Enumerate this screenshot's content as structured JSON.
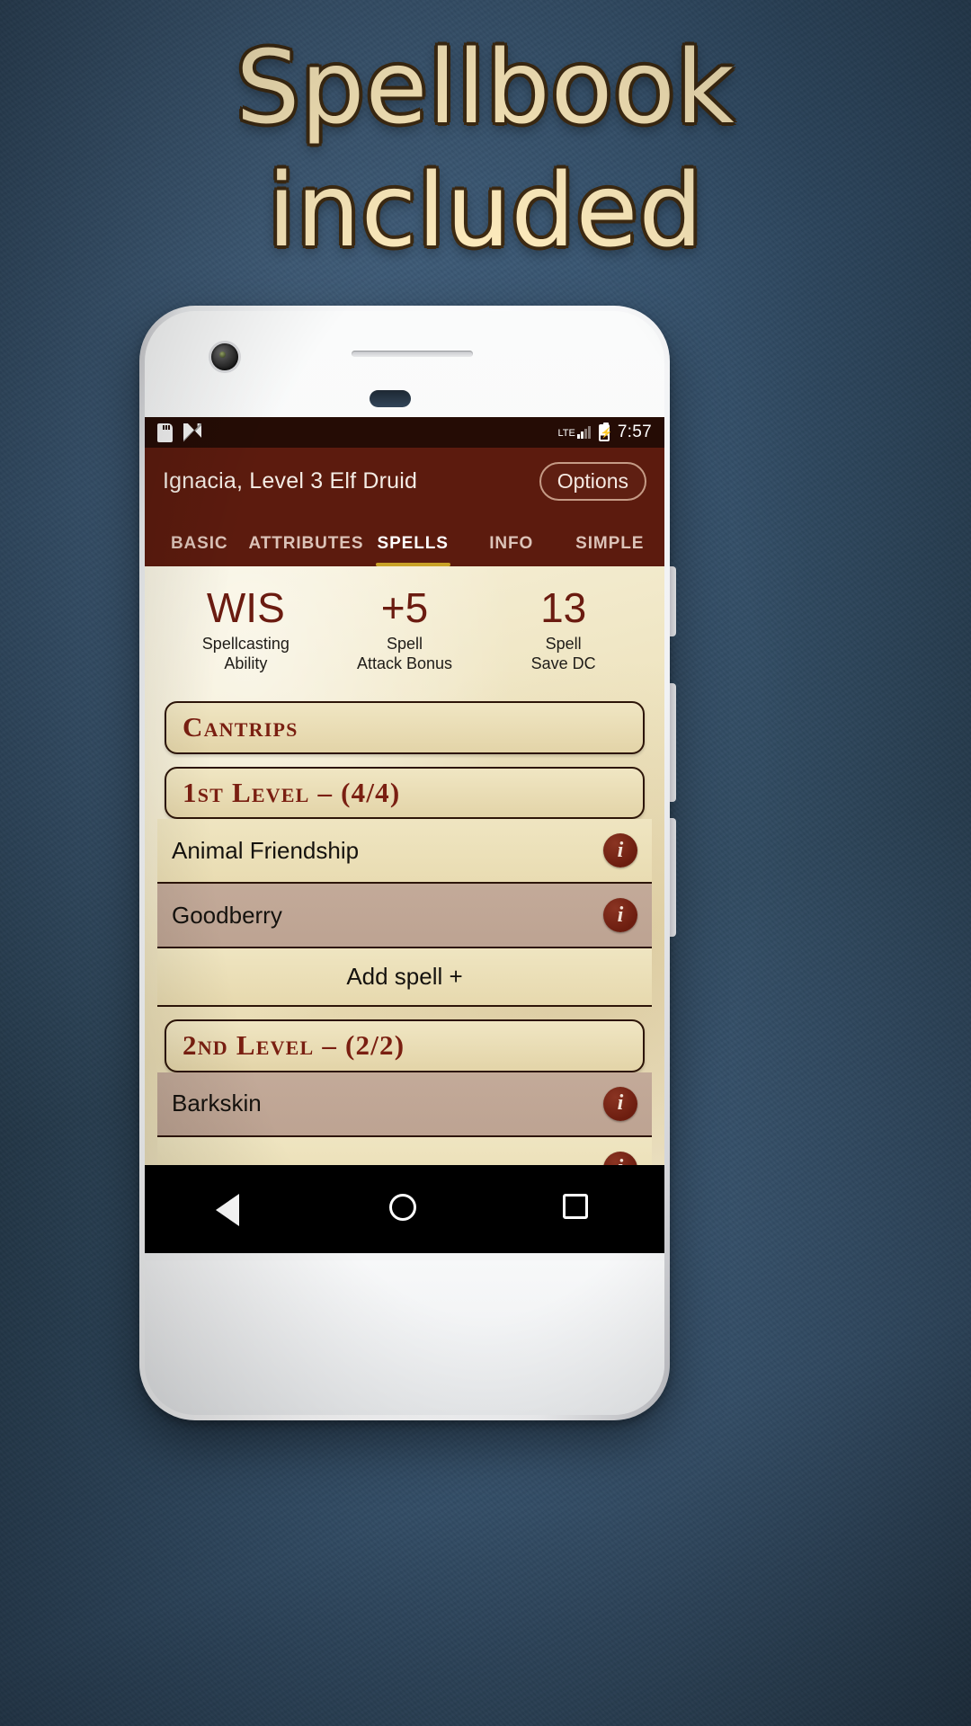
{
  "promo": {
    "line1": "Spellbook",
    "line2": "included",
    "text_color": "#fbe9bb",
    "outline_color": "#3d2a12"
  },
  "statusbar": {
    "icons": [
      "sd-card-icon",
      "android-n-icon"
    ],
    "network": "LTE",
    "battery": "charging",
    "clock": "7:57"
  },
  "appbar": {
    "character": "Ignacia, Level 3 Elf Druid",
    "options_label": "Options",
    "bg_color": "#5c1b0e",
    "tabs": [
      {
        "label": "BASIC",
        "active": false
      },
      {
        "label": "ATTRIBUTES",
        "active": false
      },
      {
        "label": "SPELLS",
        "active": true
      },
      {
        "label": "INFO",
        "active": false
      },
      {
        "label": "SIMPLE",
        "active": false
      }
    ],
    "active_indicator_color": "#c9a227"
  },
  "stats": [
    {
      "value": "WIS",
      "label_line1": "Spellcasting",
      "label_line2": "Ability"
    },
    {
      "value": "+5",
      "label_line1": "Spell",
      "label_line2": "Attack Bonus"
    },
    {
      "value": "13",
      "label_line1": "Spell",
      "label_line2": "Save DC"
    }
  ],
  "sections": [
    {
      "title": "Cantrips",
      "spells": [],
      "add_label": ""
    },
    {
      "title": "1st Level – (4/4)",
      "spells": [
        {
          "name": "Animal Friendship",
          "prepared": false,
          "info": "i"
        },
        {
          "name": "Goodberry",
          "prepared": true,
          "info": "i"
        }
      ],
      "add_label": "Add spell +"
    },
    {
      "title": "2nd Level – (2/2)",
      "spells": [
        {
          "name": "Barkskin",
          "prepared": true,
          "info": "i"
        }
      ],
      "add_label": ""
    }
  ],
  "navbar": {
    "back": "back-triangle-icon",
    "home": "home-circle-icon",
    "recents": "recents-square-icon"
  }
}
